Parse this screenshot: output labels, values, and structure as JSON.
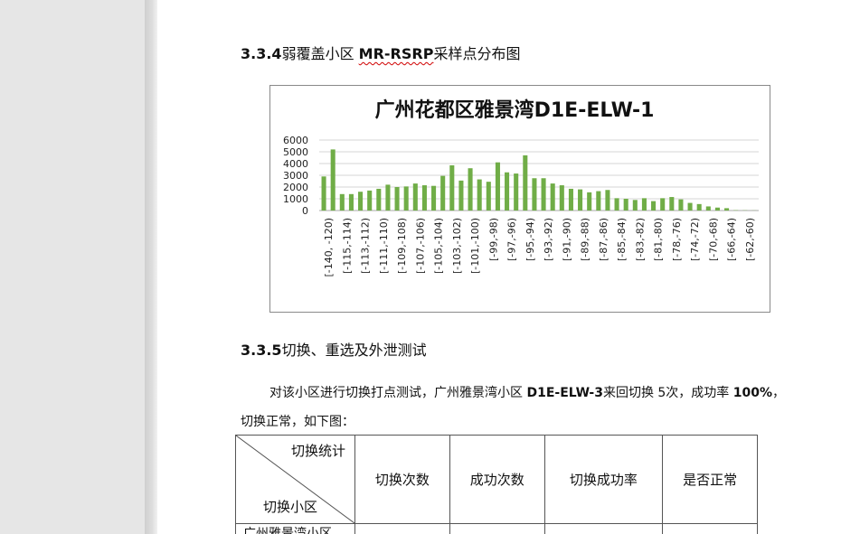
{
  "section_334": {
    "number": "3.3.4",
    "pre": "弱覆盖小区 ",
    "term": "MR-RSRP",
    "post": "采样点分布图"
  },
  "chart_data": {
    "type": "bar",
    "title": "广州花都区雅景湾D1E-ELW-1",
    "ylim": [
      0,
      6000
    ],
    "yticks": [
      0,
      1000,
      2000,
      3000,
      4000,
      5000,
      6000
    ],
    "grid": true,
    "color": "#70ad47",
    "x_tick_labels": [
      "[-140, -120)",
      "[-115,-114)",
      "[-113,-112)",
      "[-111,-110)",
      "[-109,-108)",
      "[-107,-106)",
      "[-105,-104)",
      "[-103,-102)",
      "[-101,-100)",
      "[-99,-98)",
      "[-97,-96)",
      "[-95,-94)",
      "[-93,-92)",
      "[-91,-90)",
      "[-89,-88)",
      "[-87,-86)",
      "[-85,-84)",
      "[-83,-82)",
      "[-81,-80)",
      "[-78,-76)",
      "[-74,-72)",
      "[-70,-68)",
      "[-66,-64)",
      "[-62,-60)"
    ],
    "values": [
      2900,
      5200,
      1400,
      1400,
      1600,
      1700,
      1850,
      2200,
      2000,
      2050,
      2300,
      2150,
      2100,
      2950,
      3850,
      2550,
      3600,
      2650,
      2450,
      4100,
      3250,
      3150,
      4700,
      2750,
      2750,
      2300,
      2150,
      1850,
      1800,
      1550,
      1650,
      1750,
      1050,
      1000,
      900,
      1050,
      800,
      1050,
      1150,
      950,
      650,
      550,
      350,
      250,
      200,
      30,
      20,
      10
    ]
  },
  "section_335": {
    "number": "3.3.5",
    "title": "切换、重选及外泄测试"
  },
  "paragraph": {
    "line1_a": "对该小区进行切换打点测试，广州雅景湾小区 ",
    "line1_b": "D1E-ELW-3",
    "line1_c": "来回切换 5次，成功率 ",
    "line1_d": "100%",
    "line1_e": "，",
    "line2": "切换正常，如下图："
  },
  "table": {
    "corner_top": "切换统计",
    "corner_bottom": "切换小区",
    "headers": [
      "切换次数",
      "成功次数",
      "切换成功率",
      "是否正常"
    ],
    "row1_name": "广州雅景湾小区"
  }
}
